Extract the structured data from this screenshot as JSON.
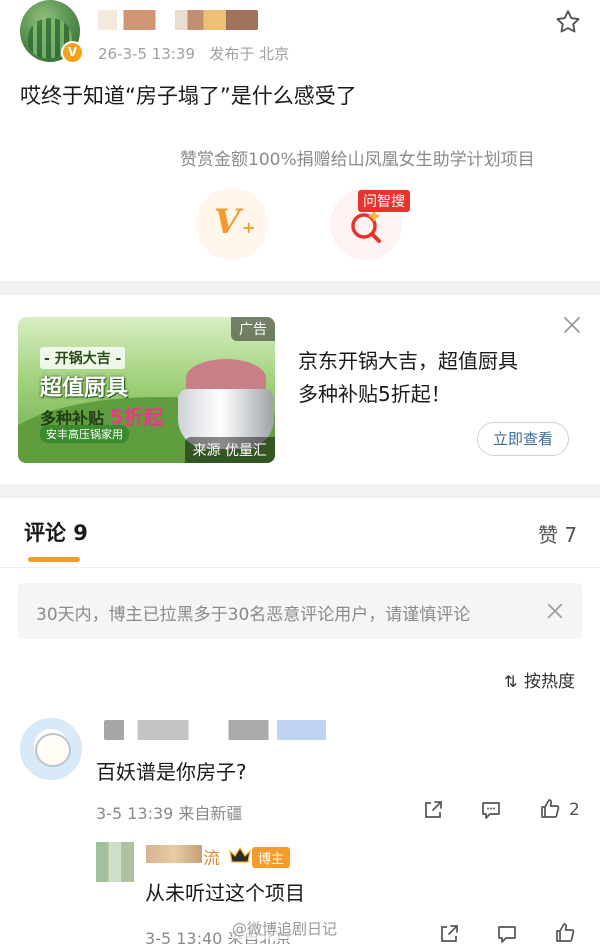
{
  "post": {
    "date": "26-3-5 13:39",
    "source": "发布于 北京",
    "text": "哎终于知道“房子塌了”是什么感受了",
    "reward_note": "赞赏金额100%捐赠给山凤凰女生助学计划项目",
    "reward_icon_text": "V",
    "reward_icon_plus": "+",
    "search_tag": "问智搜"
  },
  "ad": {
    "tag": "广告",
    "source": "来源 优量汇",
    "title_line1": "京东开锅大吉，超值厨具",
    "title_line2": "多种补贴5折起！",
    "button": "立即查看",
    "image_text": {
      "line1": "- 开锅大吉 -",
      "line2": "超值厨具",
      "line3": "多种补贴",
      "line3_hl": "5折起",
      "line4": "安丰高压锅家用"
    }
  },
  "comments_header": {
    "comments_tab": "评论 9",
    "likes_tab": "赞 7",
    "notice": "30天内，博主已拉黑多于30名恶意评论用户，请谨慎评论",
    "sort_label": "按热度"
  },
  "comments": [
    {
      "text": "百妖谱是你房子?",
      "meta": "3-5 13:39  来自新疆",
      "likes": "2"
    }
  ],
  "reply": {
    "name_tail": "流",
    "badge": "博主",
    "text": "从未听过这个项目",
    "meta": "3-5 13:40  来自北京"
  },
  "watermark": "@微博追剧日记",
  "colors": {
    "accent": "#f39b2b",
    "link_blue": "#3b6b99",
    "tag_red": "#e8332d",
    "gray_text": "#8a8a8a"
  }
}
